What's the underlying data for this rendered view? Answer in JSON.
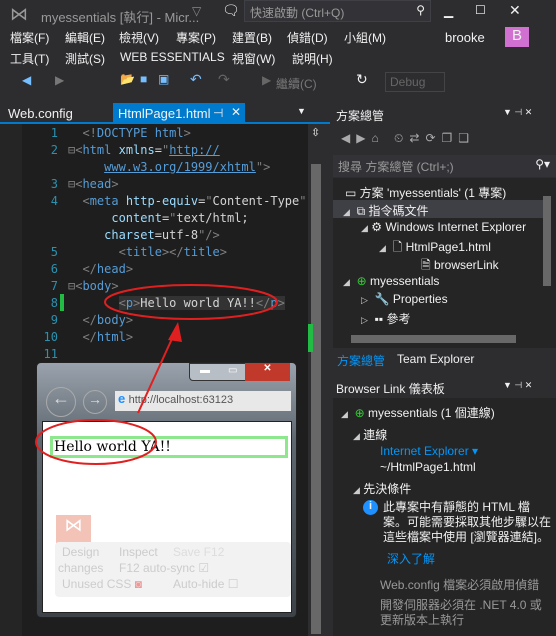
{
  "window": {
    "title": "myessentials [執行] - Micr...",
    "quick_launch": "快速啟動 (Ctrl+Q)",
    "user": "brooke",
    "avatar": "B",
    "accent": "#007acc"
  },
  "menu": {
    "row1": [
      "檔案(F)",
      "編輯(E)",
      "檢視(V)",
      "專案(P)",
      "建置(B)",
      "偵錯(D)",
      "小組(M)"
    ],
    "row2": [
      "工具(T)",
      "測試(S)",
      "WEB ESSENTIALS",
      "視窗(W)",
      "說明(H)"
    ]
  },
  "toolbar": {
    "continue": "繼續(C)",
    "config": "Debug"
  },
  "tabs": [
    {
      "label": "Web.config"
    },
    {
      "label": "HtmlPage1.html",
      "active": true
    }
  ],
  "editor": {
    "line_numbers": [
      "1",
      "2",
      "",
      "3",
      "4",
      "",
      "",
      "5",
      "6",
      "7",
      "8",
      "9",
      "10",
      "11"
    ]
  },
  "solution_explorer": {
    "title": "方案總管",
    "search_placeholder": "搜尋 方案總管 (Ctrl+;)",
    "items": [
      "方案 'myessentials' (1 專案)",
      "指令碼文件",
      "Windows Internet Explorer",
      "HtmlPage1.html",
      "browserLink",
      "myessentials",
      "Properties",
      "參考"
    ],
    "tabs": [
      "方案總管",
      "Team Explorer"
    ]
  },
  "browser_link": {
    "title": "Browser Link 儀表板",
    "project": "myessentials (1 個連線)",
    "connections": "連線",
    "browser": "Internet Explorer",
    "path": "~/HtmlPage1.html",
    "prereq": "先決條件",
    "info": "此專案中有靜態的 HTML 檔案。可能需要採取其他步驟以在這些檔案中使用 [瀏覽器連結]。",
    "learn_more": "深入了解",
    "note1": "Web.config 檔案必須啟用偵錯",
    "note2": "開發伺服器必須在 .NET 4.0 或更新版本上執行"
  },
  "browser": {
    "url": "http://localhost:63123",
    "content": "Hello world YA!!",
    "design": "Design",
    "changes": "changes",
    "inspect": "Inspect",
    "save_f12": "Save F12",
    "autosync": "F12 auto-sync",
    "unused_css": "Unused CSS",
    "autohide": "Auto-hide"
  }
}
